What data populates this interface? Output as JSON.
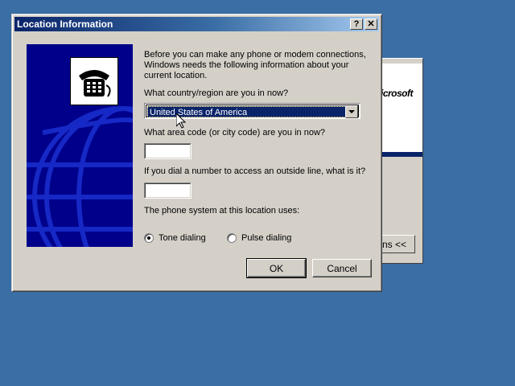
{
  "background_window": {
    "logo_text": "icrosoft",
    "button_label": "ns <<"
  },
  "dialog": {
    "title": "Location Information",
    "help_button": "?",
    "close_button": "✕",
    "intro_text": "Before you can make any phone or modem connections, Windows needs the following information about your current location.",
    "country_label": "What country/region are you in now?",
    "country_value": "United States of America",
    "area_code_label": "What area code (or city code) are you in now?",
    "area_code_value": "",
    "outside_line_label": "If you dial a number to access an outside line, what is it?",
    "outside_line_value": "",
    "phone_system_label": "The phone system at this location uses:",
    "tone_label": "Tone dialing",
    "pulse_label": "Pulse dialing",
    "tone_selected": true,
    "ok_label": "OK",
    "cancel_label": "Cancel"
  },
  "colors": {
    "desktop": "#3a6ea5",
    "title_gradient_start": "#0a246a",
    "banner": "#00008a",
    "face": "#d4d0c8"
  }
}
